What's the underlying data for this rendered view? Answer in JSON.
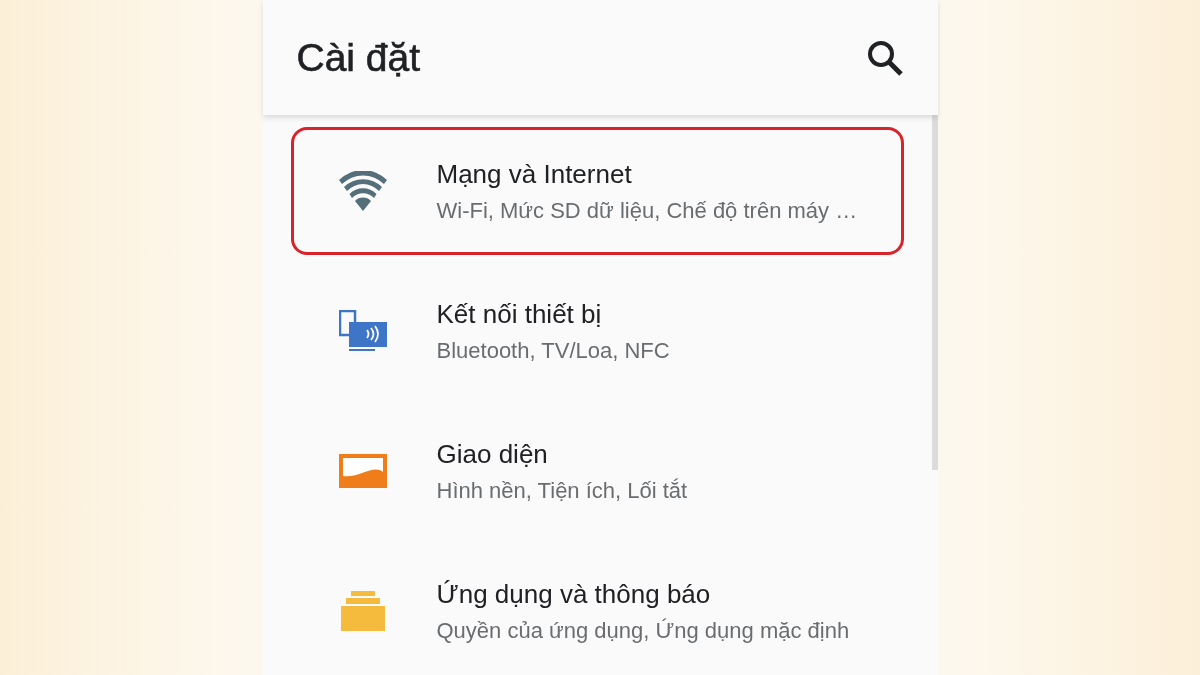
{
  "app_bar": {
    "title": "Cài đặt"
  },
  "settings": [
    {
      "kind": "wifi",
      "title": "Mạng và Internet",
      "subtitle": "Wi-Fi, Mức SD dữ liệu, Chế độ trên máy …",
      "highlighted": true
    },
    {
      "kind": "devices",
      "title": "Kết nối thiết bị",
      "subtitle": "Bluetooth, TV/Loa, NFC",
      "highlighted": false
    },
    {
      "kind": "display",
      "title": "Giao diện",
      "subtitle": "Hình nền, Tiện ích, Lối tắt",
      "highlighted": false
    },
    {
      "kind": "apps",
      "title": "Ứng dụng và thông báo",
      "subtitle": "Quyền của ứng dụng, Ứng dụng mặc định",
      "highlighted": false
    }
  ]
}
